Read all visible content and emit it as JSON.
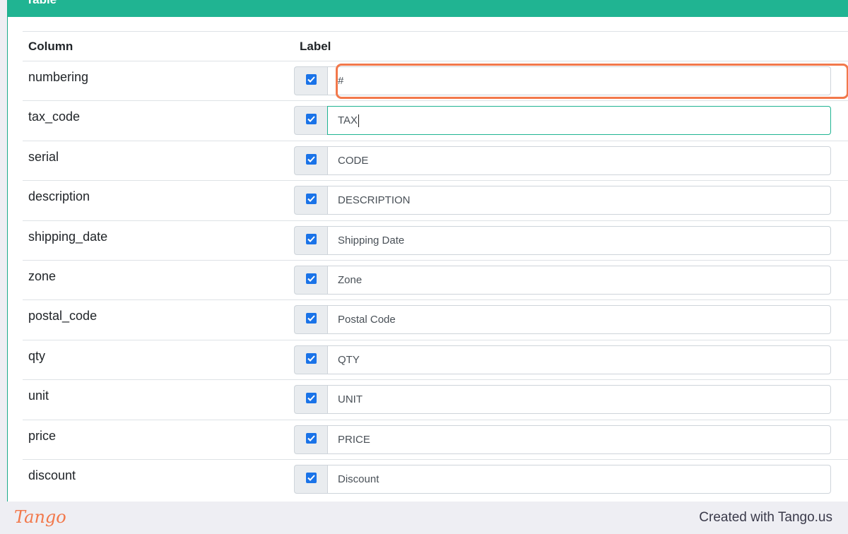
{
  "panel": {
    "title": "Table",
    "collapse_icon": "chevron-up-icon"
  },
  "table": {
    "headers": [
      "Column",
      "Label"
    ],
    "rows": [
      {
        "column": "numbering",
        "checked": true,
        "label": "#"
      },
      {
        "column": "tax_code",
        "checked": true,
        "label": "TAX"
      },
      {
        "column": "serial",
        "checked": true,
        "label": "CODE"
      },
      {
        "column": "description",
        "checked": true,
        "label": "DESCRIPTION"
      },
      {
        "column": "shipping_date",
        "checked": true,
        "label": "Shipping Date"
      },
      {
        "column": "zone",
        "checked": true,
        "label": "Zone"
      },
      {
        "column": "postal_code",
        "checked": true,
        "label": "Postal Code"
      },
      {
        "column": "qty",
        "checked": true,
        "label": "QTY"
      },
      {
        "column": "unit",
        "checked": true,
        "label": "UNIT"
      },
      {
        "column": "price",
        "checked": true,
        "label": "PRICE"
      },
      {
        "column": "discount",
        "checked": true,
        "label": "Discount"
      }
    ]
  },
  "footer": {
    "logo": "Tango",
    "credit": "Created with Tango.us"
  },
  "colors": {
    "accent": "#20b492",
    "highlight": "#f2784b",
    "checkbox": "#1a73e8"
  }
}
